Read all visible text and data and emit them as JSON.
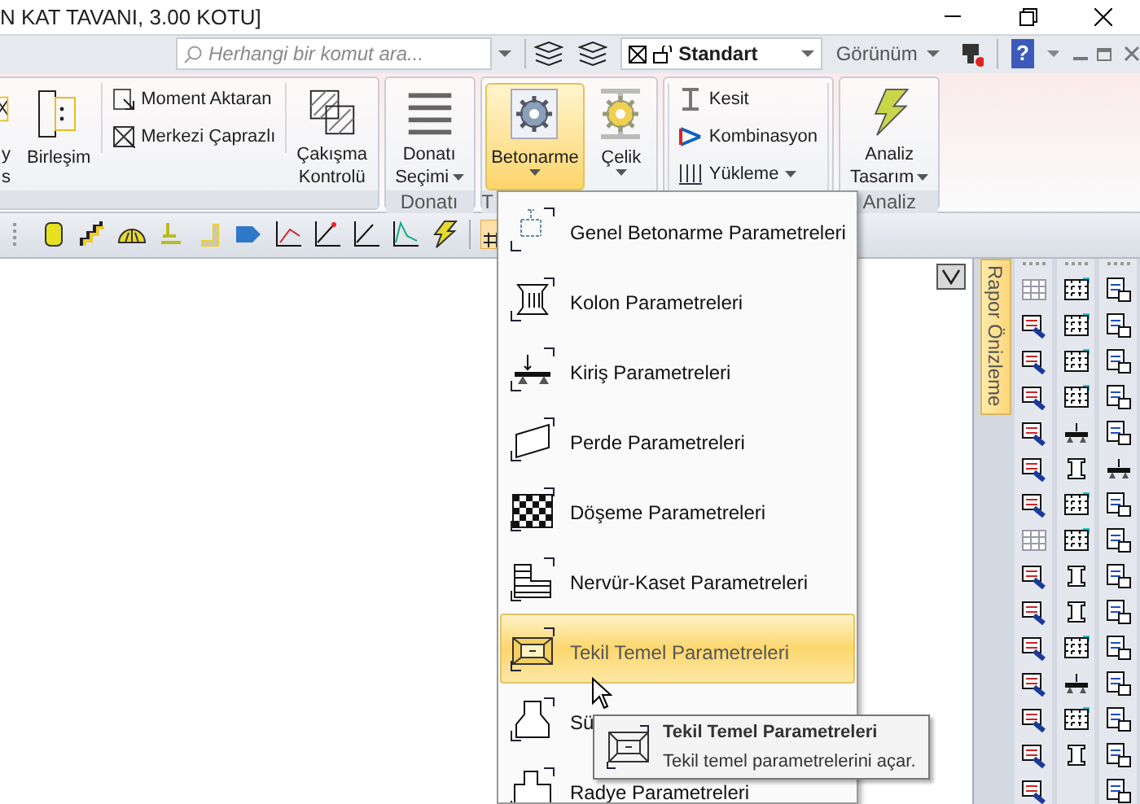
{
  "title_bar": {
    "title": "N KAT TAVANI,  3.00 KOTU]"
  },
  "quick_access": {
    "search": {
      "placeholder": "Herhangi bir komut ara..."
    },
    "style_dropdown": {
      "value": "Standart"
    },
    "view_menu": {
      "label": "Görünüm"
    },
    "help_button": {
      "label": "?"
    }
  },
  "ribbon": {
    "groups": [
      {
        "items": [
          {
            "kind": "large",
            "lines": [
              "y",
              "s"
            ]
          },
          {
            "kind": "large",
            "lines": [
              "Birleşim"
            ]
          },
          {
            "kind": "small",
            "label": "Moment Aktaran"
          },
          {
            "kind": "small",
            "label": "Merkezi Çaprazlı"
          },
          {
            "kind": "large",
            "lines": [
              "Çakışma",
              "Kontrolü"
            ]
          }
        ]
      },
      {
        "label": "Donatı",
        "items": [
          {
            "kind": "large",
            "lines": [
              "Donatı",
              "Seçimi"
            ],
            "dropdown": true
          }
        ]
      },
      {
        "label": "T",
        "items": [
          {
            "kind": "large",
            "lines": [
              "Betonarme"
            ],
            "dropdown": true,
            "selected": true
          },
          {
            "kind": "large",
            "lines": [
              "Çelik"
            ],
            "dropdown": true,
            "selected": false
          }
        ]
      },
      {
        "items": [
          {
            "kind": "small",
            "label": "Kesit"
          },
          {
            "kind": "small",
            "label": "Kombinasyon"
          },
          {
            "kind": "small",
            "label": "Yükleme",
            "dropdown": true
          }
        ]
      },
      {
        "label": "Analiz",
        "items": [
          {
            "kind": "large",
            "lines": [
              "Analiz",
              "Tasarım"
            ],
            "dropdown": true
          }
        ]
      }
    ]
  },
  "side_panel": {
    "tab": "Rapor Önizleme"
  },
  "dropdown_menu": {
    "items": [
      {
        "label": "Genel Betonarme Parametreleri",
        "selected": false
      },
      {
        "label": "Kolon Parametreleri",
        "selected": false
      },
      {
        "label": "Kiriş Parametreleri",
        "selected": false
      },
      {
        "label": "Perde Parametreleri",
        "selected": false
      },
      {
        "label": "Döşeme Parametreleri",
        "selected": false
      },
      {
        "label": "Nervür-Kaset Parametreleri",
        "selected": false
      },
      {
        "label": "Tekil Temel Parametreleri",
        "selected": true
      },
      {
        "label": "Sü",
        "selected": false
      },
      {
        "label": "Radye Parametreleri",
        "selected": false
      }
    ]
  },
  "tooltip": {
    "title": "Tekil Temel Parametreleri",
    "text": "Tekil temel parametrelerini açar."
  }
}
